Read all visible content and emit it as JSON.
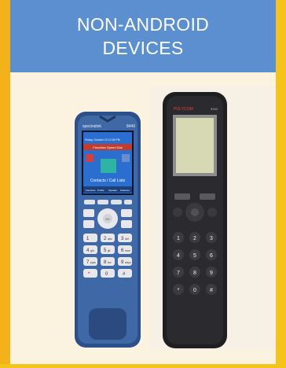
{
  "header": {
    "title": "NON-ANDROID\nDEVICES"
  },
  "phone_left": {
    "brand": "spectralink",
    "model": "8440",
    "status_line": "Friday, October 10 12:25 PM",
    "banner": "Favorites Speed Dial",
    "screen_label": "Contacts / Call Lists",
    "softkeys": [
      "Favorites",
      "Profile",
      "Speaker",
      "Features"
    ],
    "keys": [
      {
        "main": "1",
        "sub": ""
      },
      {
        "main": "2",
        "sub": "abc"
      },
      {
        "main": "3",
        "sub": "def"
      },
      {
        "main": "4",
        "sub": "ghi"
      },
      {
        "main": "5",
        "sub": "jkl"
      },
      {
        "main": "6",
        "sub": "mno"
      },
      {
        "main": "7",
        "sub": "pqrs"
      },
      {
        "main": "8",
        "sub": "tuv"
      },
      {
        "main": "9",
        "sub": "wxyz"
      },
      {
        "main": "*",
        "sub": ""
      },
      {
        "main": "0",
        "sub": ""
      },
      {
        "main": "#",
        "sub": ""
      }
    ],
    "nav_center": "OK",
    "colors": {
      "body": "#2f4e86",
      "screen": "#2a6fd0",
      "keys": "#e8e8ec"
    }
  },
  "phone_right": {
    "brand": "POLYCOM",
    "model": "5340",
    "keys": [
      "1",
      "2",
      "3",
      "4",
      "5",
      "6",
      "7",
      "8",
      "9",
      "*",
      "0",
      "#"
    ],
    "colors": {
      "body": "#1f1f22",
      "screen": "#d7d9b4"
    }
  }
}
